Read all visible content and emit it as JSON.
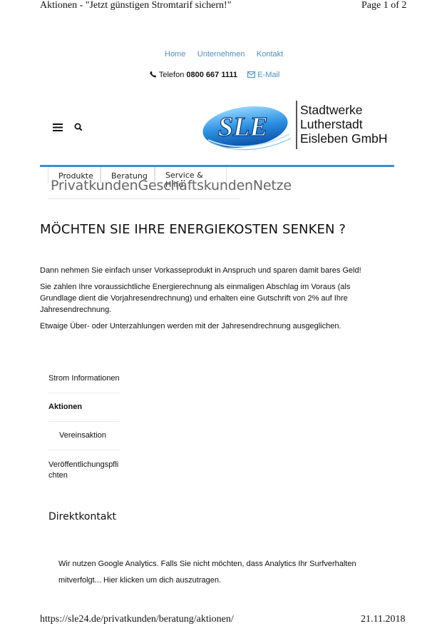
{
  "print_header": {
    "title": "Aktionen - \"Jetzt günstigen Stromtarif sichern!\"",
    "page": "Page 1 of 2"
  },
  "topnav": [
    "Home",
    "Unternehmen",
    "Kontakt"
  ],
  "contact": {
    "phone_label": "Telefon",
    "phone_number": "0800 667 1111",
    "email_label": "E-Mail"
  },
  "logo": {
    "mark": "SLE",
    "line1": "Stadtwerke",
    "line2": "Lutherstadt",
    "line3": "Eisleben GmbH"
  },
  "tabs": [
    "Produkte",
    "Beratung",
    "Service & Hilfe"
  ],
  "segments": [
    "Privatkunden",
    "Geschäftskunden",
    "Netze"
  ],
  "heading": "MÖCHTEN SIE IHRE ENERGIEKOSTEN SENKEN ?",
  "paragraphs": [
    "Dann nehmen Sie einfach unser Vorkasseprodukt in Anspruch und sparen damit bares Geld!",
    "Sie zahlen Ihre voraussichtliche Energierechnung als einmaligen Abschlag im Voraus (als Grundlage dient die Vorjahresendrechnung) und erhalten eine Gutschrift von 2% auf Ihre Jahresendrechnung.",
    "Etwaige Über- oder Unterzahlungen werden mit der Jahresendrechnung ausgeglichen."
  ],
  "sidebar": {
    "items": [
      "Strom Informationen",
      "Aktionen",
      "Vereinsaktion",
      "Veröffentlichungspfli",
      "chten"
    ]
  },
  "direktkontakt": "Direktkontakt",
  "analytics": {
    "line1": "Wir nutzen Google Analytics. Falls Sie nicht möchten, dass Analytics Ihr Surfverhalten",
    "line2": "mitverfolgt... Hier klicken um dich auszutragen."
  },
  "print_footer": {
    "url": "https://sle24.de/privatkunden/beratung/aktionen/",
    "date": "21.11.2018"
  },
  "colors": {
    "link": "#4a90c0",
    "accent_bar": "#3a8fd0",
    "logo_blue": "#1f6fc0"
  },
  "icons": [
    "hamburger-menu-icon",
    "search-icon",
    "phone-icon",
    "envelope-icon"
  ]
}
